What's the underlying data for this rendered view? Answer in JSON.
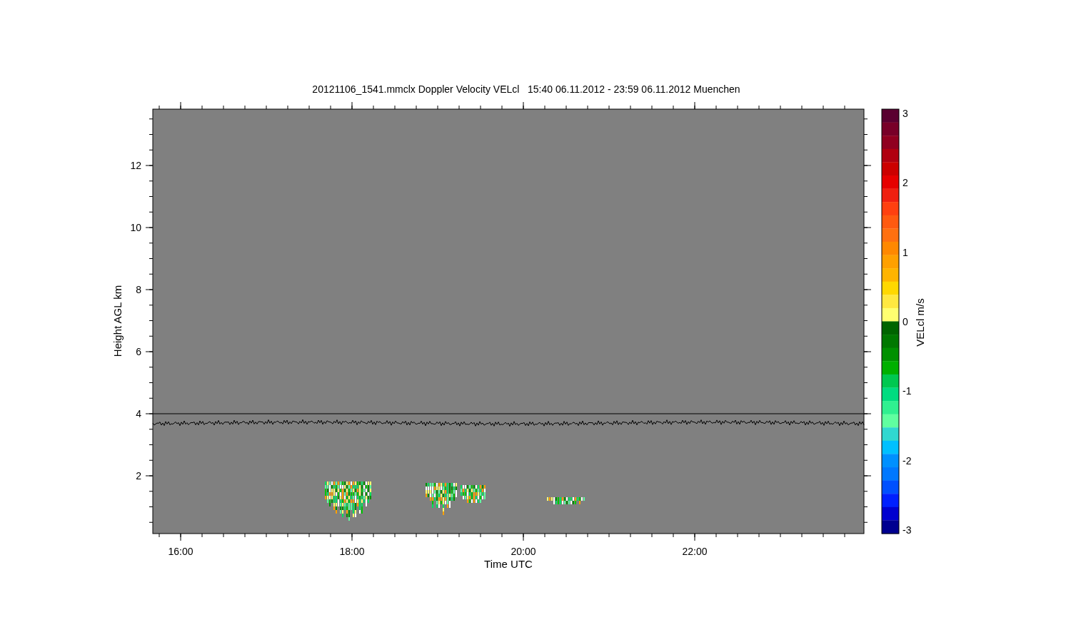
{
  "title": "20121106_1541.mmclx Doppler Velocity VELcl   15:40 06.11.2012 - 23:59 06.11.2012 Muenchen",
  "y_axis": {
    "label": "Height AGL km",
    "ticks": [
      "12",
      "10",
      "8",
      "6",
      "4",
      "2"
    ]
  },
  "x_axis": {
    "label": "Time UTC",
    "ticks": [
      "16:00",
      "18:00",
      "20:00",
      "22:00"
    ]
  },
  "colorbar": {
    "label": "VELcl m/s",
    "ticks": [
      "3",
      "2",
      "1",
      "0",
      "-1",
      "-2",
      "-3"
    ],
    "segments": [
      {
        "color": "#5a0030"
      },
      {
        "color": "#780028"
      },
      {
        "color": "#900020"
      },
      {
        "color": "#b00010"
      },
      {
        "color": "#cc0000"
      },
      {
        "color": "#e60000"
      },
      {
        "color": "#f02010"
      },
      {
        "color": "#ff4010"
      },
      {
        "color": "#ff5a10"
      },
      {
        "color": "#ff7010"
      },
      {
        "color": "#ff8800"
      },
      {
        "color": "#ffa000"
      },
      {
        "color": "#ffb400"
      },
      {
        "color": "#ffd800"
      },
      {
        "color": "#ffe840"
      },
      {
        "color": "#ffff70"
      },
      {
        "color": "#006400"
      },
      {
        "color": "#007800"
      },
      {
        "color": "#009000"
      },
      {
        "color": "#00b000"
      },
      {
        "color": "#00c850"
      },
      {
        "color": "#00dc80"
      },
      {
        "color": "#30f090"
      },
      {
        "color": "#60ffa0"
      },
      {
        "color": "#30d8d0"
      },
      {
        "color": "#00c0ff"
      },
      {
        "color": "#0090ff"
      },
      {
        "color": "#0078ff"
      },
      {
        "color": "#0050ff"
      },
      {
        "color": "#0020ff"
      },
      {
        "color": "#0000d0"
      },
      {
        "color": "#000090"
      }
    ]
  }
}
